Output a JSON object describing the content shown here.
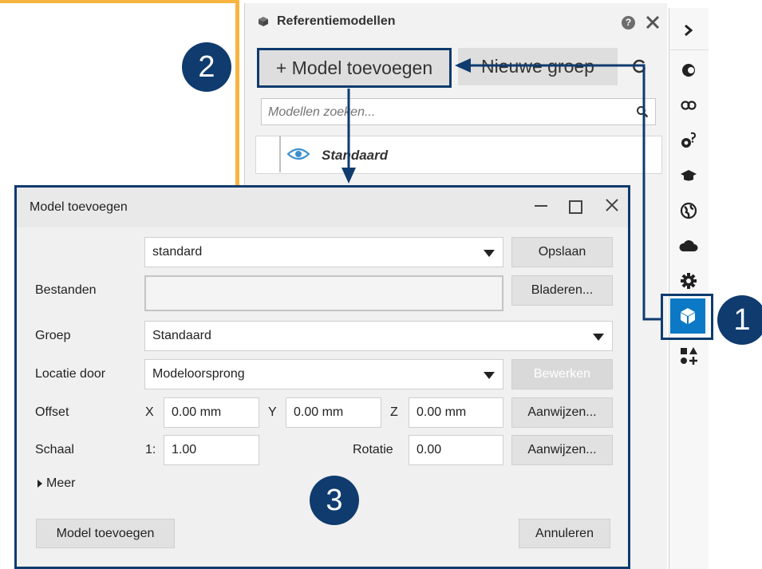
{
  "panel": {
    "title": "Referentiemodellen",
    "help_label": "?",
    "add_model_label": "+ Model toevoegen",
    "new_group_label": "Nieuwe groep",
    "search_placeholder": "Modellen zoeken...",
    "tree_item_label": "Standaard"
  },
  "callouts": [
    "1",
    "2",
    "3"
  ],
  "dialog": {
    "title": "Model toevoegen",
    "preset_value": "standard",
    "save_label": "Opslaan",
    "files_label": "Bestanden",
    "browse_label": "Bladeren...",
    "group_label": "Groep",
    "group_value": "Standaard",
    "location_label": "Locatie door",
    "location_value": "Modeloorsprong",
    "edit_label": "Bewerken",
    "offset_label": "Offset",
    "x_label": "X",
    "x_value": "0.00 mm",
    "y_label": "Y",
    "y_value": "0.00 mm",
    "z_label": "Z",
    "z_value": "0.00 mm",
    "pick_label": "Aanwijzen...",
    "scale_label": "Schaal",
    "scale_prefix": "1:",
    "scale_value": "1.00",
    "rotation_label": "Rotatie",
    "rotation_value": "0.00",
    "pick2_label": "Aanwijzen...",
    "more_label": "Meer",
    "add_button_label": "Model toevoegen",
    "cancel_label": "Annuleren"
  },
  "colors": {
    "accent": "#0b79c6",
    "callout": "#0f3b6e",
    "canvas_border": "#f7b43e"
  },
  "rail_icons": [
    "chevron-right-icon",
    "component-icon",
    "link-icon",
    "settings-question-icon",
    "graduation-cap-icon",
    "globe-icon",
    "cloud-icon",
    "gear-icon",
    "cube-icon",
    "shapes-add-icon"
  ]
}
